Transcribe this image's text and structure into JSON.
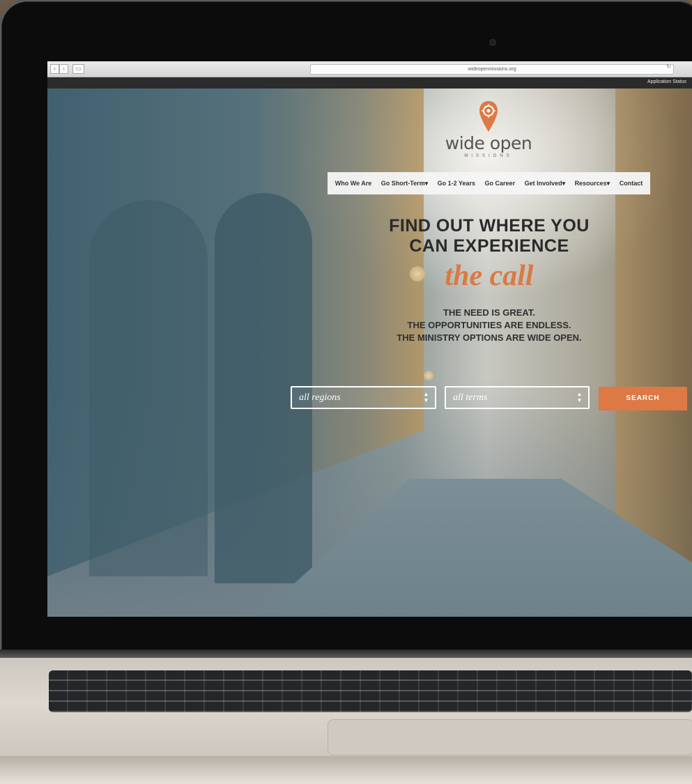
{
  "browser": {
    "url": "wideopenmissions.org",
    "back_glyph": "‹",
    "forward_glyph": "›",
    "sidebar_glyph": "▭",
    "reload_glyph": "↻"
  },
  "topbar": {
    "application_status": "Application Status"
  },
  "logo": {
    "text": "wide open",
    "subtitle": "MISSIONS",
    "icon": "map-pin-icon"
  },
  "nav": {
    "items": [
      {
        "label": "Who We Are"
      },
      {
        "label": "Go Short-Term▾"
      },
      {
        "label": "Go 1-2 Years"
      },
      {
        "label": "Go Career"
      },
      {
        "label": "Get Involved▾"
      },
      {
        "label": "Resources▾"
      },
      {
        "label": "Contact"
      }
    ]
  },
  "hero": {
    "headline_line1": "FIND OUT WHERE YOU",
    "headline_line2": "CAN EXPERIENCE",
    "headline_script": "the call",
    "sub_line1": "THE NEED IS GREAT.",
    "sub_line2": "THE OPPORTUNITIES ARE ENDLESS.",
    "sub_line3": "THE MINISTRY OPTIONS ARE WIDE OPEN."
  },
  "search": {
    "region_value": "all regions",
    "term_value": "all terms",
    "button_label": "SEARCH",
    "arrow_glyph": "▲▼"
  },
  "colors": {
    "accent": "#dd7944",
    "text_dark": "#2a2a2a",
    "nav_bg": "#f5f5f5"
  }
}
